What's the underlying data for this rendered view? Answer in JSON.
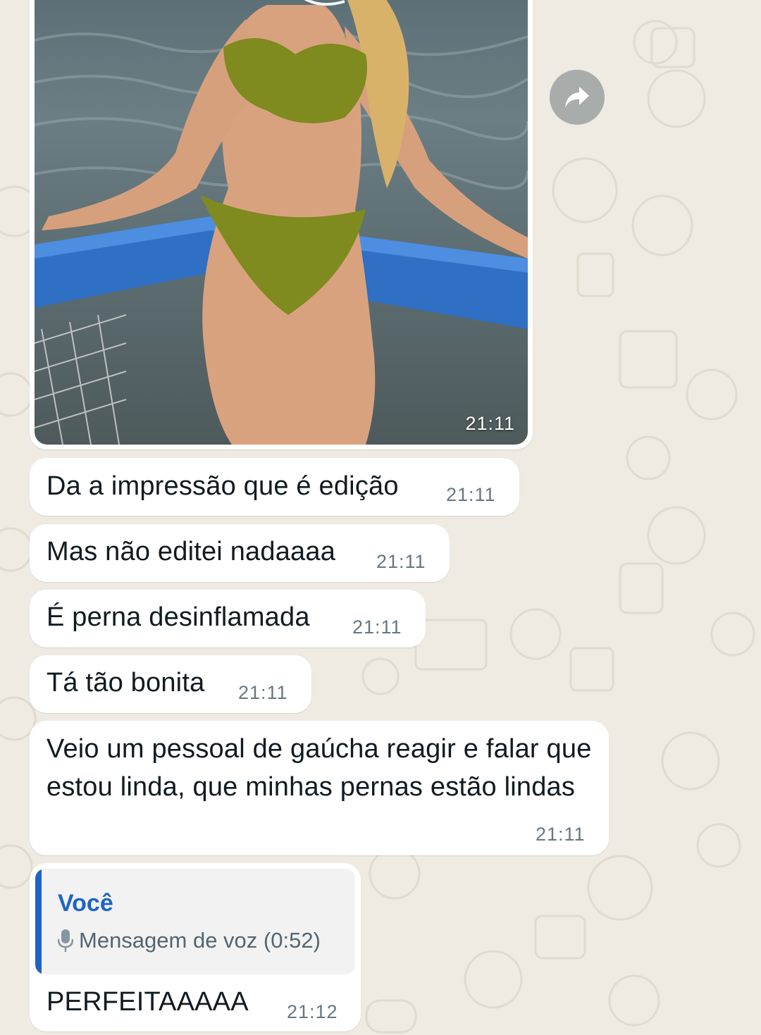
{
  "image_message": {
    "time": "21:11"
  },
  "messages": [
    {
      "text": "Da a impressão que é edição",
      "time": "21:11"
    },
    {
      "text": "Mas não editei nadaaaa",
      "time": "21:11"
    },
    {
      "text": "É perna desinflamada",
      "time": "21:11"
    },
    {
      "text": "Tá tão bonita",
      "time": "21:11"
    },
    {
      "text": "Veio um pessoal de gaúcha reagir e falar que estou linda, que minhas pernas estão lindas",
      "time": "21:11"
    }
  ],
  "reply_message": {
    "quote_author": "Você",
    "quote_text": "Mensagem de voz (0:52)",
    "text": "PERFEITAAAAA",
    "time": "21:12"
  },
  "colors": {
    "background": "#efeae2",
    "bubble": "#ffffff",
    "quote_accent": "#1d64c4",
    "time_text": "#667781"
  },
  "icons": {
    "forward": "forward-arrow-icon",
    "mic": "microphone-icon"
  }
}
